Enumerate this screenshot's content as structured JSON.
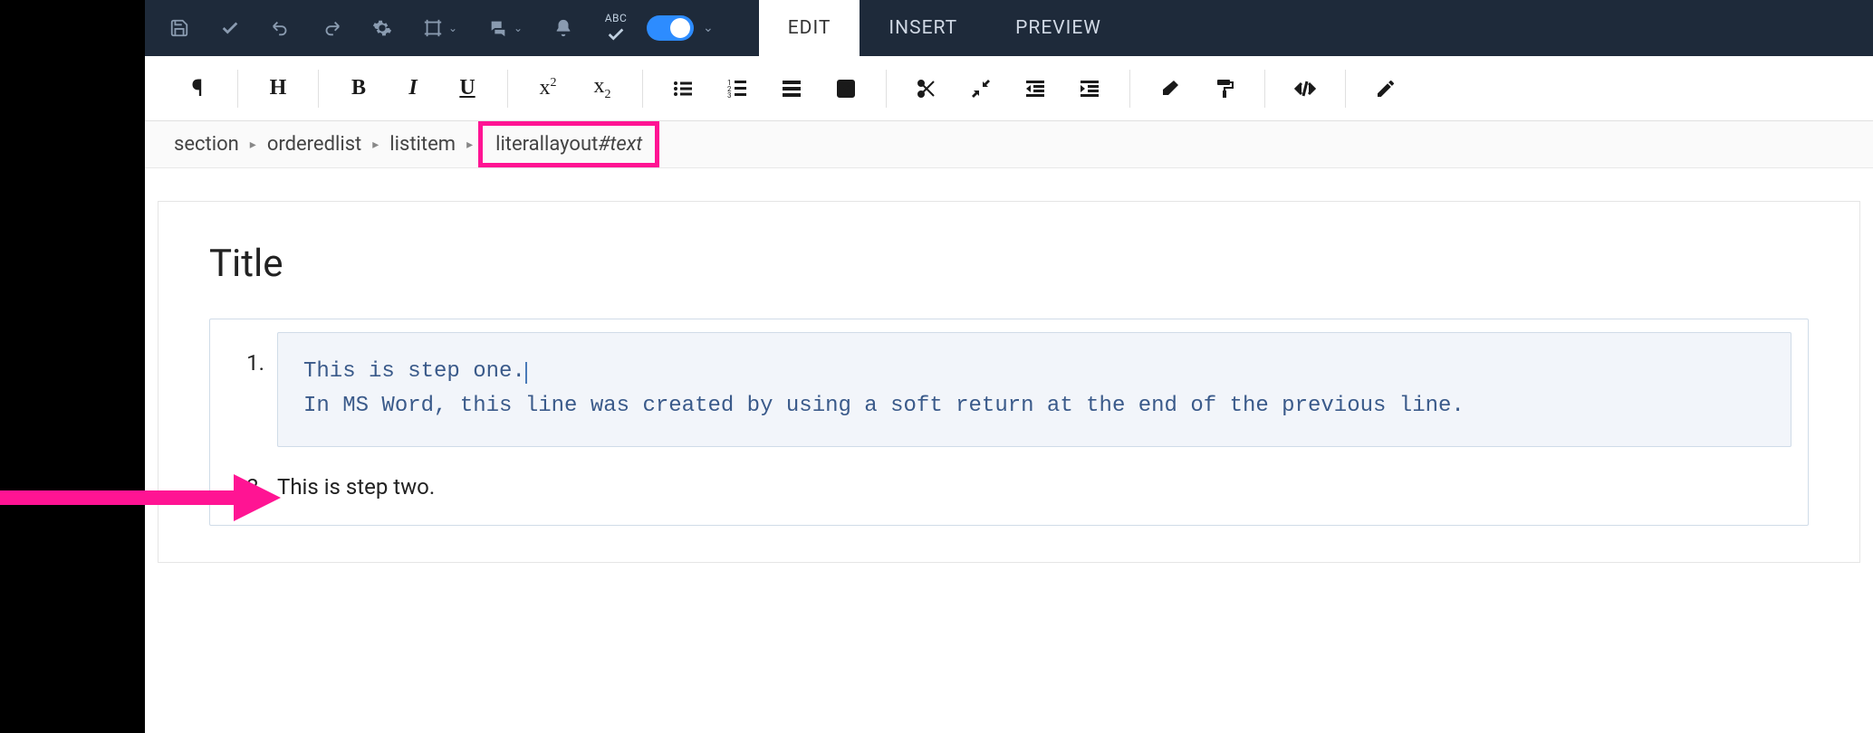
{
  "topbar": {
    "abc_label": "ABC"
  },
  "tabs": {
    "edit": "EDIT",
    "insert": "INSERT",
    "preview": "PREVIEW"
  },
  "breadcrumb": {
    "items": [
      "section",
      "orderedlist",
      "listitem"
    ],
    "highlighted": "literallayout",
    "highlighted_suffix": "#text"
  },
  "document": {
    "title": "Title",
    "list": {
      "items": [
        {
          "number": "1.",
          "type": "code",
          "lines": [
            "This is step one.",
            "In MS Word, this line was created by using a soft return at the end of the previous line."
          ]
        },
        {
          "number": "2.",
          "type": "plain",
          "text": "This is step two."
        }
      ]
    }
  },
  "format_buttons": {
    "heading": "H",
    "bold": "B",
    "italic": "I",
    "underline": "U",
    "super": "x",
    "super_exp": "2",
    "sub": "x",
    "sub_exp": "2"
  },
  "colors": {
    "topbar_bg": "#1e2a3a",
    "toggle_on": "#2d8cff",
    "highlight": "#ff1493",
    "code_bg": "#f2f5fa",
    "code_text": "#3a5a8a"
  }
}
